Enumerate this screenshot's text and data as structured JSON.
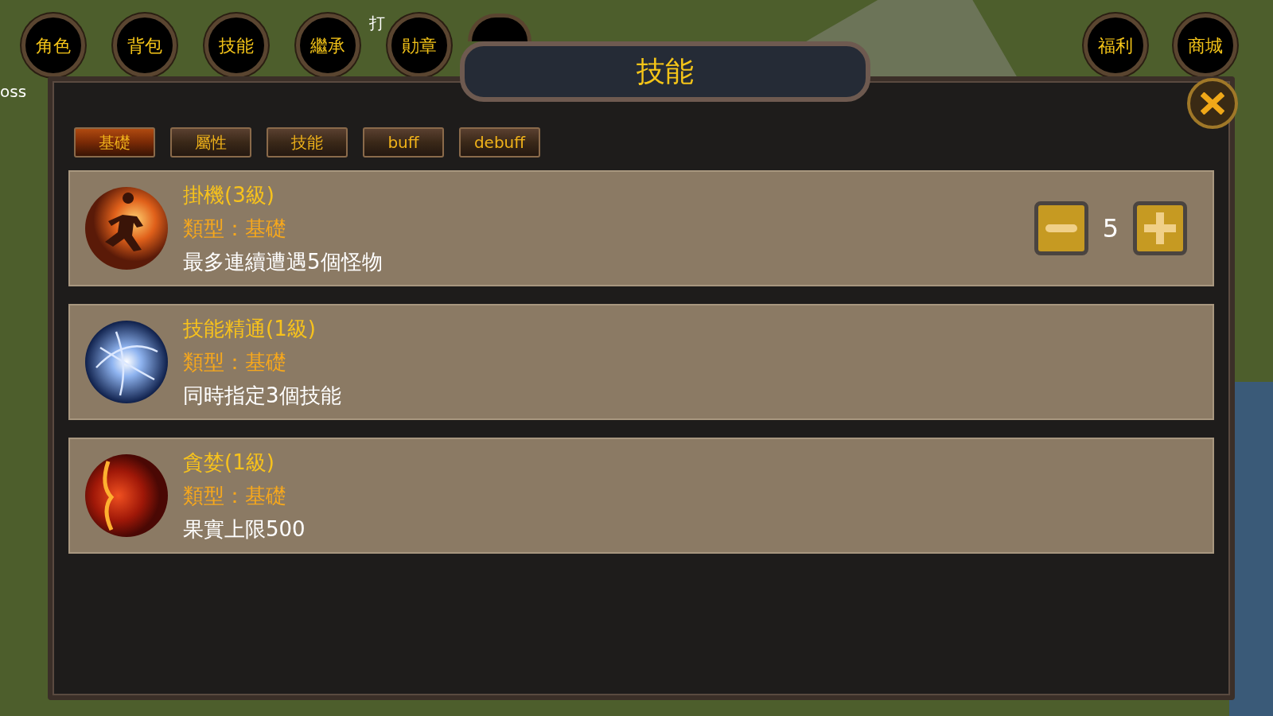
{
  "map_labels": [
    {
      "text": "oss"
    },
    {
      "text": "打"
    }
  ],
  "hud_buttons_left": [
    {
      "label": "角色"
    },
    {
      "label": "背包"
    },
    {
      "label": "技能"
    },
    {
      "label": "繼承"
    },
    {
      "label": "勛章"
    }
  ],
  "hud_buttons_right": [
    {
      "label": "福利"
    },
    {
      "label": "商城"
    }
  ],
  "window": {
    "title": "技能"
  },
  "tabs": [
    {
      "label": "基礎",
      "selected": true
    },
    {
      "label": "屬性",
      "selected": false
    },
    {
      "label": "技能",
      "selected": false
    },
    {
      "label": "buff",
      "selected": false
    },
    {
      "label": "debuff",
      "selected": false
    }
  ],
  "skills": [
    {
      "kind": "fire",
      "name": "掛機(3級)",
      "type": "類型：基礎",
      "description": "最多連續遭遇5個怪物",
      "stepper": {
        "value": "5"
      }
    },
    {
      "kind": "energy",
      "name": "技能精通(1級)",
      "type": "類型：基礎",
      "description": "同時指定3個技能"
    },
    {
      "kind": "rage",
      "name": "貪婪(1級)",
      "type": "類型：基礎",
      "description": "果實上限500"
    }
  ]
}
